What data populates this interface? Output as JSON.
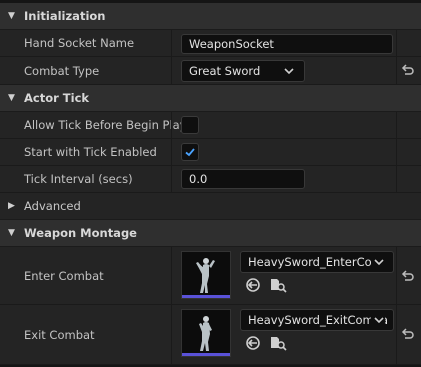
{
  "initialization": {
    "header": "Initialization",
    "hand_socket": {
      "label": "Hand Socket Name",
      "value": "WeaponSocket"
    },
    "combat_type": {
      "label": "Combat Type",
      "value": "Great Sword"
    }
  },
  "actor_tick": {
    "header": "Actor Tick",
    "allow_tick": {
      "label": "Allow Tick Before Begin Play",
      "checked": false
    },
    "start_tick": {
      "label": "Start with Tick Enabled",
      "checked": true
    },
    "tick_interval": {
      "label": "Tick Interval (secs)",
      "value": "0.0"
    },
    "advanced": "Advanced"
  },
  "weapon_montage": {
    "header": "Weapon Montage",
    "enter": {
      "label": "Enter Combat",
      "asset": "HeavySword_EnterCom"
    },
    "exit": {
      "label": "Exit Combat",
      "asset": "HeavySword_ExitComba"
    }
  },
  "colors": {
    "accent": "#5a52d8",
    "checkmark": "#4aa3ff"
  },
  "icons": [
    "chevron-down-icon",
    "chevron-right-icon",
    "reset-arrow-icon",
    "use-selected-icon",
    "browse-asset-icon",
    "checkmark-icon"
  ]
}
